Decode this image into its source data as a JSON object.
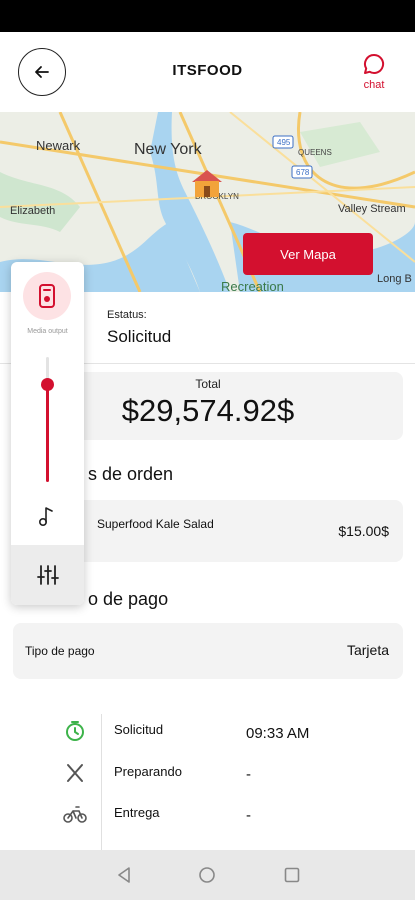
{
  "header": {
    "title": "ITSFOOD",
    "chat_label": "chat"
  },
  "map": {
    "button_label": "Ver Mapa",
    "place_labels": [
      "Newark",
      "New York",
      "QUEENS",
      "Elizabeth",
      "BROOKLYN",
      "Valley Stream",
      "Long B",
      "Recreation",
      "495",
      "678"
    ]
  },
  "status": {
    "label": "Estatus:",
    "value": "Solicitud"
  },
  "total": {
    "label": "Total",
    "value": "$29,574.92$"
  },
  "order": {
    "section_title": "s de orden",
    "item_name": "Superfood Kale Salad",
    "item_price": "$15.00$"
  },
  "payment": {
    "section_title": "o de pago",
    "type_label": "Tipo de pago",
    "type_value": "Tarjeta"
  },
  "timeline": [
    {
      "icon": "timer-icon",
      "step": "Solicitud",
      "time": "09:33 AM"
    },
    {
      "icon": "utensils-icon",
      "step": "Preparando",
      "time": "-"
    },
    {
      "icon": "bicycle-icon",
      "step": "Entrega",
      "time": "-"
    }
  ],
  "volume_panel": {
    "output_label": "Media output",
    "level": 0.78
  },
  "colors": {
    "accent": "#d3102f",
    "card_bg": "#f3f3f3"
  }
}
